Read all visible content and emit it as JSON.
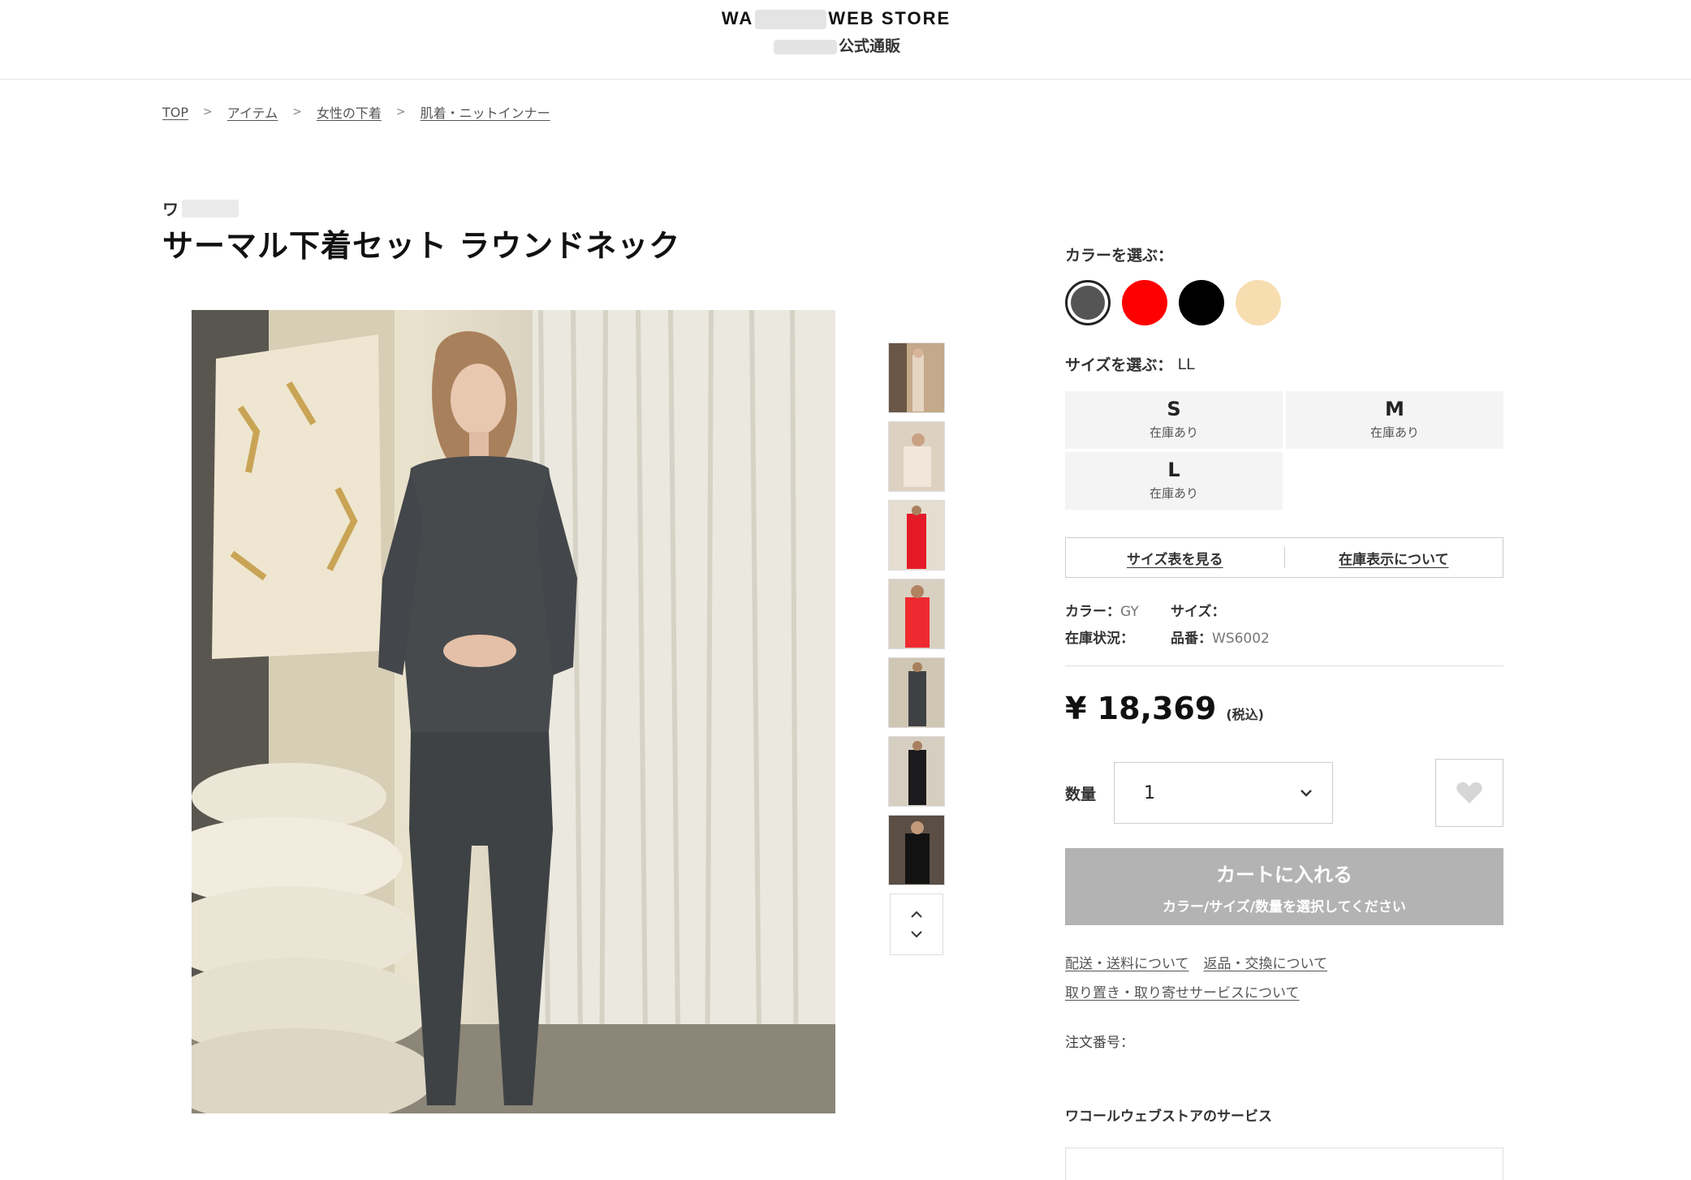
{
  "header": {
    "logo_prefix": "WA",
    "logo_suffix": "WEB STORE",
    "sub": "公式通販"
  },
  "breadcrumb": [
    "TOP",
    "アイテム",
    "女性の下着",
    "肌着・ニットインナー"
  ],
  "product": {
    "brand": "ワ",
    "title": "サーマル下着セット ラウンドネック"
  },
  "color": {
    "label": "カラーを選ぶ：",
    "swatches": [
      {
        "color": "#555555",
        "selected": true
      },
      {
        "color": "#ff0000",
        "selected": false
      },
      {
        "color": "#000000",
        "selected": false
      },
      {
        "color": "#f7ddb0",
        "selected": false
      }
    ]
  },
  "size": {
    "label": "サイズを選ぶ：",
    "value": "LL",
    "options": [
      {
        "size": "S",
        "stock": "在庫あり"
      },
      {
        "size": "M",
        "stock": "在庫あり"
      },
      {
        "size": "L",
        "stock": "在庫あり"
      }
    ]
  },
  "links": {
    "size_chart": "サイズ表を見る",
    "stock_info": "在庫表示について"
  },
  "info": {
    "color_label": "カラー：",
    "color_value": "GY",
    "size_label": "サイズ：",
    "stock_label": "在庫状況：",
    "code_label": "品番：",
    "code_value": "WS6002"
  },
  "price": {
    "amount": "¥ 18,369",
    "tax": "(税込)"
  },
  "quantity": {
    "label": "数量",
    "value": "1"
  },
  "cart": {
    "label": "カートに入れる",
    "sub": "カラー/サイズ/数量を選択してください"
  },
  "footer_links": {
    "shipping": "配送・送料について",
    "returns": "返品・交換について",
    "pickup": "取り置き・取り寄せサービスについて"
  },
  "order_no": "注文番号：",
  "service_title": "ワコールウェブストアのサービス"
}
